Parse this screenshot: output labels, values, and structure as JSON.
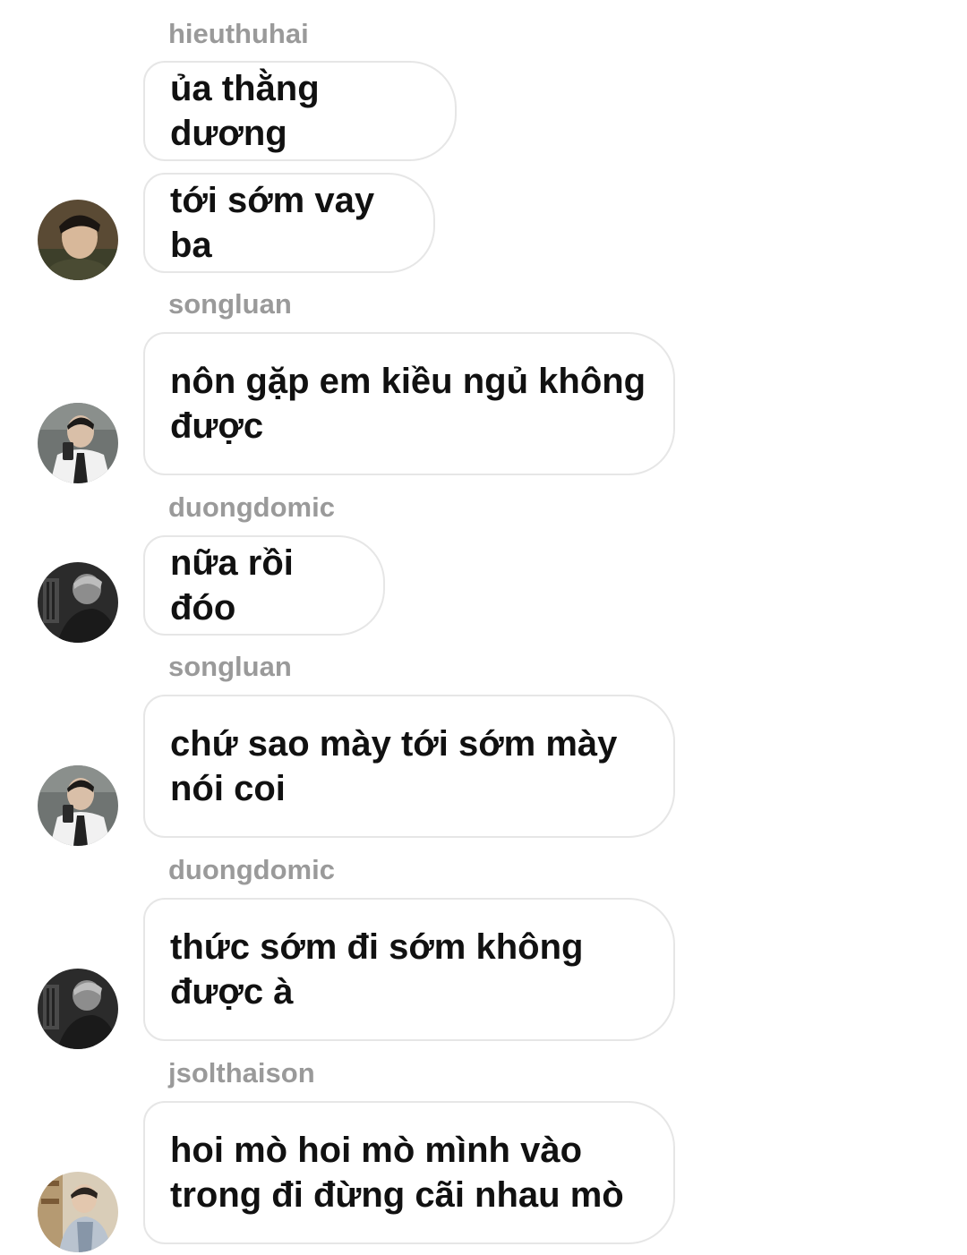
{
  "messages": [
    {
      "sender": "hieuthuhai",
      "text": "ủa thằng dương"
    },
    {
      "text": "tới sớm vay ba"
    },
    {
      "sender": "songluan",
      "text": "nôn gặp em kiều ngủ không\nđược"
    },
    {
      "sender": "duongdomic",
      "text": "nữa rồi đóo"
    },
    {
      "sender": "songluan",
      "text": "chứ sao mày tới sớm mày\nnói coi"
    },
    {
      "sender": "duongdomic",
      "text": "thức sớm đi sớm không\nđược à"
    },
    {
      "sender": "jsolthaison",
      "text": "hoi mò hoi mò mình vào\ntrong đi đừng cãi nhau mò"
    }
  ],
  "avatars": [
    {
      "user": "hieuthuhai",
      "icon": "user-avatar-photo"
    },
    {
      "user": "songluan",
      "icon": "user-avatar-photo"
    },
    {
      "user": "duongdomic",
      "icon": "user-avatar-photo"
    },
    {
      "user": "songluan",
      "icon": "user-avatar-photo"
    },
    {
      "user": "duongdomic",
      "icon": "user-avatar-photo"
    },
    {
      "user": "jsolthaison",
      "icon": "user-avatar-photo"
    }
  ],
  "colors": {
    "sender_name": "#9a9a9a",
    "bubble_border": "#e6e6e6",
    "message_text": "#111111",
    "background": "#ffffff"
  }
}
